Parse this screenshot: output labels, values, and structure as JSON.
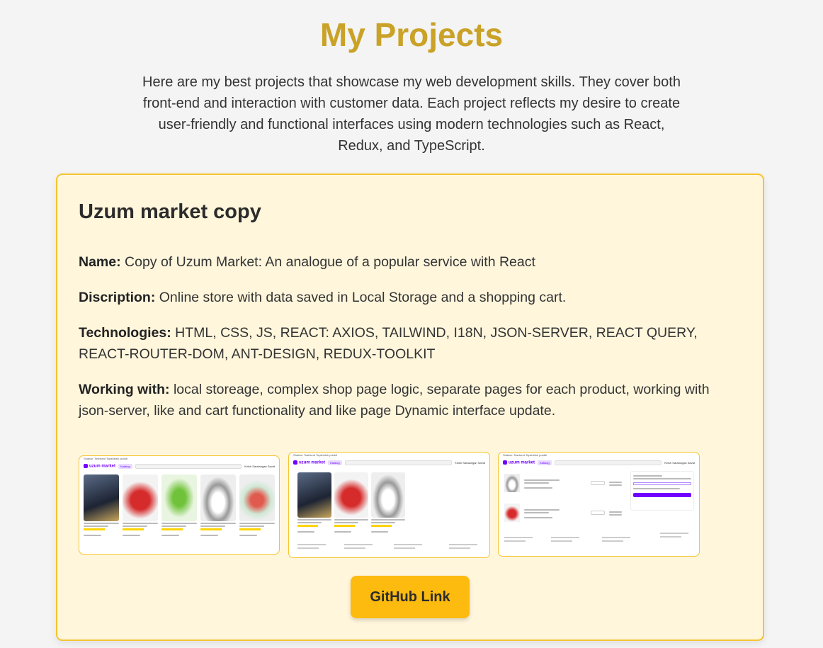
{
  "header": {
    "title": "My Projects",
    "intro": "Here are my best projects that showcase my web development skills. They cover both front-end and interaction with customer data. Each project reflects my desire to create user-friendly and functional interfaces using modern technologies such as React, Redux, and TypeScript."
  },
  "project": {
    "title": "Uzum market copy",
    "name_label": "Name:",
    "name_value": " Copy of Uzum Market: An analogue of a popular service with React",
    "description_label": "Discription:",
    "description_value": " Online store with data saved in Local Storage and a shopping cart.",
    "technologies_label": "Technologies:",
    "technologies_value": " HTML, CSS, JS, REACT: AXIOS, TAILWIND, I18N, JSON-SERVER, REACT QUERY, REACT-ROUTER-DOM, ANT-DESIGN, REDUX-TOOLKIT",
    "working_label": "Working with:",
    "working_value": " local storeage, complex shop page logic, separate pages for each product, working with json-server, like and cart functionality and like page Dynamic interface update.",
    "github_button": "GitHub Link",
    "screenshots": {
      "logo_text": "uzum market",
      "catalog_label": "Katalog",
      "topbar_city": "Shahar: Toshkent  Topshirish punkti",
      "topbar_right": "Sotuvchi bo'lish  Topshirish punkti  O'zbekcha",
      "header_links": "Kirish  Saralangan  Savat"
    },
    "colors": {
      "accent": "#c9a227",
      "card_bg": "#fff6dc",
      "card_border": "#f5c431",
      "button": "#fdbb0f",
      "brand": "#7000ff"
    }
  }
}
